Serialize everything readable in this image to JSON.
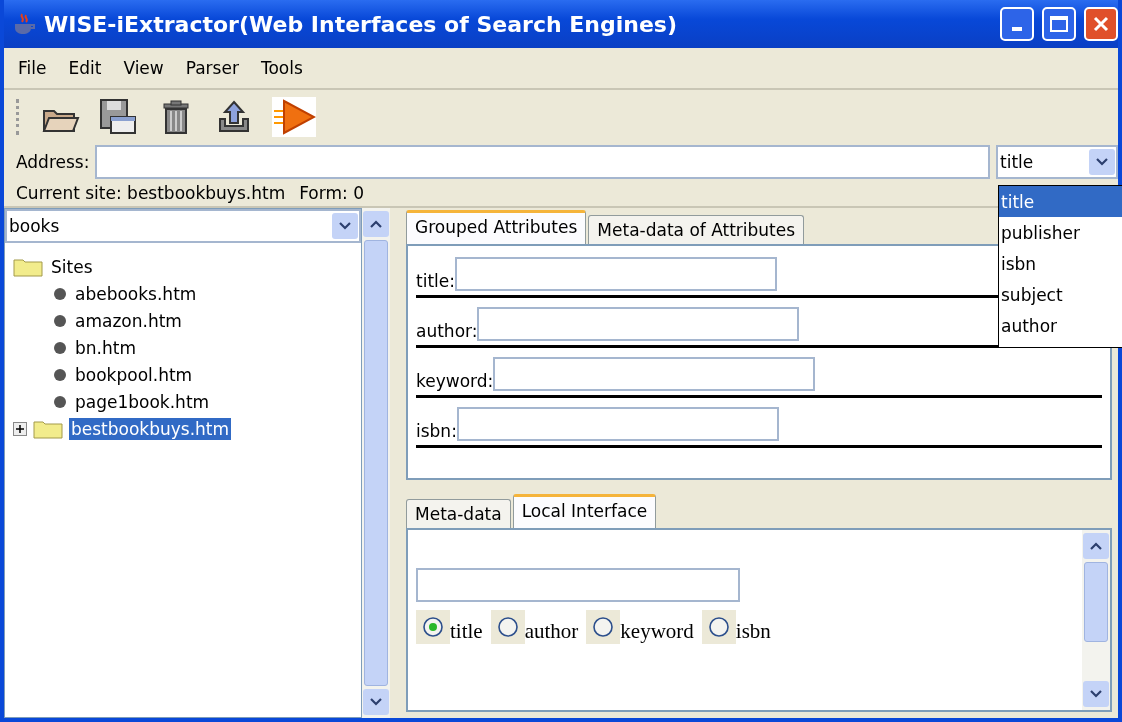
{
  "window": {
    "title": "WISE-iExtractor(Web Interfaces of Search Engines)"
  },
  "menu": [
    "File",
    "Edit",
    "View",
    "Parser",
    "Tools"
  ],
  "toolbar": [
    {
      "kind": "open"
    },
    {
      "kind": "save"
    },
    {
      "kind": "delete"
    },
    {
      "kind": "upload"
    },
    {
      "kind": "run"
    }
  ],
  "address": {
    "label": "Address:",
    "attribute": "title",
    "options": [
      {
        "label": "title",
        "selected": true
      },
      {
        "label": "publisher",
        "selected": false
      },
      {
        "label": "isbn",
        "selected": false
      },
      {
        "label": "subject",
        "selected": false
      },
      {
        "label": "author",
        "selected": false
      }
    ]
  },
  "status": {
    "site": "Current site: bestbookbuys.htm",
    "form": "Form: 0"
  },
  "sidebar": {
    "domain": "books",
    "tree": [
      {
        "label": "Sites",
        "kind": "folder",
        "selected": false,
        "expanded": true,
        "children": [
          {
            "label": "abebooks.htm",
            "kind": "leaf",
            "selected": false
          },
          {
            "label": "amazon.htm",
            "kind": "leaf",
            "selected": false
          },
          {
            "label": "bn.htm",
            "kind": "leaf",
            "selected": false
          },
          {
            "label": "bookpool.htm",
            "kind": "leaf",
            "selected": false
          },
          {
            "label": "page1book.htm",
            "kind": "leaf",
            "selected": false
          }
        ]
      },
      {
        "label": "bestbookbuys.htm",
        "kind": "folder",
        "selected": true,
        "expanded": false
      }
    ]
  },
  "top_tabs": [
    {
      "label": "Grouped Attributes",
      "selected": true
    },
    {
      "label": "Meta-data of Attributes",
      "selected": false
    }
  ],
  "grouped_attributes": [
    {
      "label": "title:"
    },
    {
      "label": "author:"
    },
    {
      "label": "keyword:"
    },
    {
      "label": "isbn:"
    }
  ],
  "bottom_tabs": [
    {
      "label": "Meta-data",
      "selected": false
    },
    {
      "label": "Local Interface",
      "selected": true
    }
  ],
  "local_interface": {
    "radios": [
      {
        "label": "title",
        "selected": true
      },
      {
        "label": "author",
        "selected": false
      },
      {
        "label": "keyword",
        "selected": false
      },
      {
        "label": "isbn",
        "selected": false
      }
    ]
  }
}
